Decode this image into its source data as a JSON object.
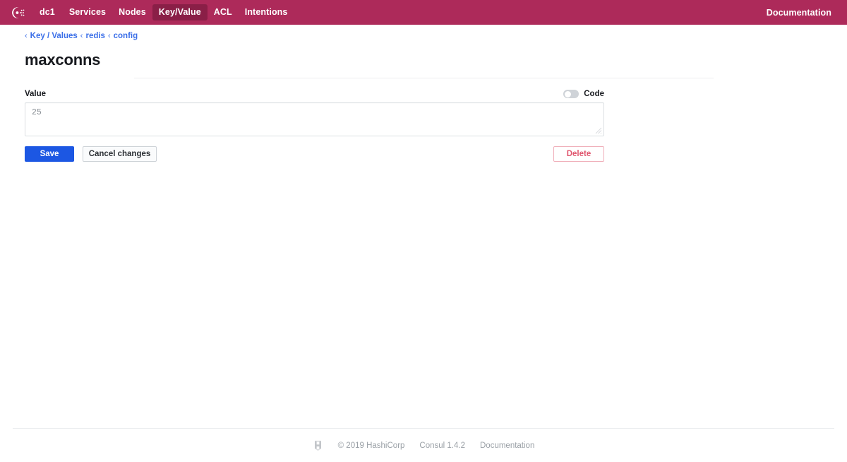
{
  "header": {
    "brand_icon": "consul-logo-icon",
    "brand_color": "#ad2a5a",
    "active_color": "#8a1f47",
    "nav_items": [
      {
        "label": "dc1",
        "active": false,
        "name": "nav-item-dc1"
      },
      {
        "label": "Services",
        "active": false,
        "name": "nav-item-services"
      },
      {
        "label": "Nodes",
        "active": false,
        "name": "nav-item-nodes"
      },
      {
        "label": "Key/Value",
        "active": true,
        "name": "nav-item-key-value"
      },
      {
        "label": "ACL",
        "active": false,
        "name": "nav-item-acl"
      },
      {
        "label": "Intentions",
        "active": false,
        "name": "nav-item-intentions"
      }
    ],
    "documentation_label": "Documentation"
  },
  "breadcrumb": {
    "separator": "‹",
    "items": [
      {
        "label": "Key / Values"
      },
      {
        "label": "redis"
      },
      {
        "label": "config"
      }
    ],
    "link_color": "#3b6fe8"
  },
  "main": {
    "page_title": "maxconns",
    "value_label": "Value",
    "code_toggle": {
      "label": "Code",
      "enabled": false,
      "icon": "toggle-off-icon"
    },
    "value_field": {
      "value": "25",
      "placeholder": "Value"
    },
    "buttons": {
      "save": "Save",
      "cancel": "Cancel changes",
      "delete": "Delete"
    },
    "colors": {
      "save_bg": "#1c57e3",
      "delete_border": "#f0aeb9",
      "delete_text": "#e0566e"
    }
  },
  "footer": {
    "logo_icon": "hashicorp-logo-icon",
    "copyright": "© 2019 HashiCorp",
    "version": "Consul 1.4.2",
    "documentation_label": "Documentation"
  }
}
